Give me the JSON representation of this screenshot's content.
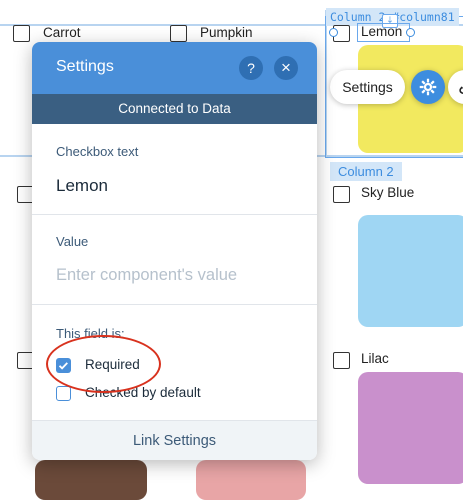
{
  "canvas": {
    "top_row": [
      "Carrot",
      "Pumpkin",
      "Lemon"
    ],
    "mid_row": [
      "",
      "",
      "Sky Blue"
    ],
    "bottom_row": [
      "",
      "",
      "Lilac"
    ],
    "column_tag_top": "Column 2  #column81",
    "column_tag": "Column 2",
    "settings_button_label": "Settings",
    "colors": {
      "lemon": "#f2e95f",
      "sky_blue": "#9fd6f3",
      "lilac": "#c990cc",
      "brown": "#6b4a3a",
      "pink": "#e8a5a6",
      "guide": "#b8d4f0",
      "accent": "#3d8ddf"
    }
  },
  "panel": {
    "title": "Settings",
    "help_icon": "?",
    "close_icon": "×",
    "banner": "Connected to Data",
    "checkbox_text_label": "Checkbox text",
    "checkbox_text_value": "Lemon",
    "value_label": "Value",
    "value_placeholder": "Enter component's value",
    "field_is_label": "This field is:",
    "options": [
      {
        "label": "Required",
        "checked": true
      },
      {
        "label": "Checked by default",
        "checked": false
      }
    ],
    "footer_link": "Link Settings",
    "colors": {
      "header": "#4a8fd9",
      "banner": "#3a5f82",
      "checked": "#4a8fd9",
      "annotation": "#d8321e"
    }
  }
}
